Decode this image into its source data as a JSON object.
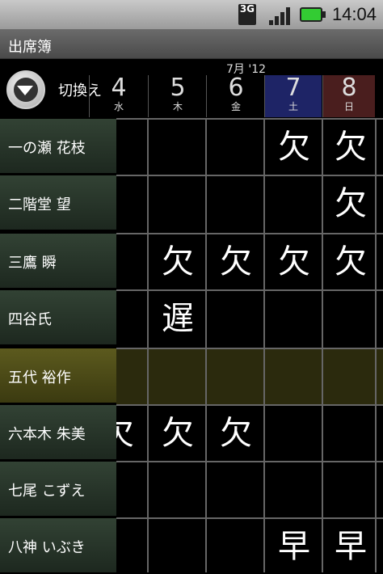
{
  "status_bar": {
    "network_label": "3G",
    "time": "14:04"
  },
  "app": {
    "title": "出席簿"
  },
  "toggle": {
    "label": "切換え"
  },
  "calendar": {
    "month_label": "7月 '12",
    "days": [
      {
        "num": "4",
        "weekday": "水"
      },
      {
        "num": "5",
        "weekday": "木"
      },
      {
        "num": "6",
        "weekday": "金"
      },
      {
        "num": "7",
        "weekday": "土"
      },
      {
        "num": "8",
        "weekday": "日"
      }
    ],
    "day_colors": {
      "weekday_bg": "#000000",
      "saturday_bg": "#1e2466",
      "sunday_bg": "#4a1e1e"
    }
  },
  "members": [
    {
      "name": "一の瀬 花枝",
      "marks": [
        "",
        "",
        "",
        "欠",
        "欠"
      ]
    },
    {
      "name": "二階堂 望",
      "marks": [
        "",
        "",
        "",
        "",
        "欠"
      ]
    },
    {
      "name": "三鷹 瞬",
      "marks": [
        "",
        "欠",
        "欠",
        "欠",
        "欠"
      ]
    },
    {
      "name": "四谷氏",
      "marks": [
        "",
        "遅",
        "",
        "",
        ""
      ]
    },
    {
      "name": "五代 裕作",
      "marks": [
        "",
        "",
        "",
        "",
        ""
      ],
      "highlighted": true
    },
    {
      "name": "六本木 朱美",
      "marks": [
        "欠",
        "欠",
        "欠",
        "",
        ""
      ]
    },
    {
      "name": "七尾 こずえ",
      "marks": [
        "",
        "",
        "",
        "",
        ""
      ]
    },
    {
      "name": "八神 いぶき",
      "marks": [
        "",
        "",
        "",
        "早",
        "早"
      ]
    }
  ]
}
